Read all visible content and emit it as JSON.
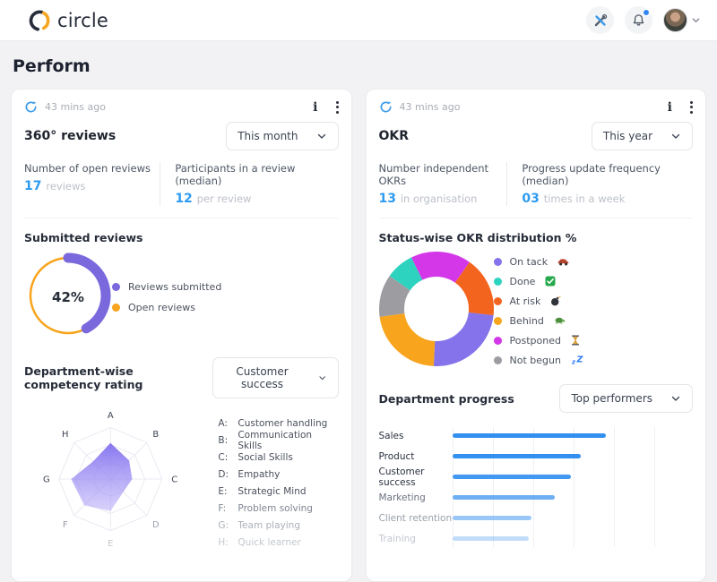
{
  "header": {
    "brand": "circle",
    "brand_colors": {
      "dark": "#272d3b",
      "accent": "#f5a623"
    }
  },
  "page_title": "Perform",
  "cards": [
    {
      "last_updated": "43 mins ago",
      "title": "360° reviews",
      "period": "This month",
      "stats": [
        {
          "label": "Number of open reviews",
          "value": "17",
          "unit": "reviews"
        },
        {
          "label": "Participants in a review (median)",
          "value": "12",
          "unit": "per review"
        }
      ],
      "donut": {
        "type": "donut",
        "title": "Submitted reviews",
        "center_label": "42%",
        "segments": [
          {
            "label": "Reviews submitted",
            "value": 42,
            "color": "#7a68dd"
          },
          {
            "label": "Open reviews",
            "value": 58,
            "color": "#f8a41d"
          }
        ]
      },
      "radar": {
        "type": "radar",
        "title": "Department-wise competency rating",
        "filter": "Customer success",
        "max": 1,
        "rings": 3,
        "fill_color_top": "rgba(124,106,238,0.92)",
        "fill_color_bottom": "rgba(168,155,246,0.45)",
        "grid_color": "#ebe9f2",
        "axes": [
          {
            "key": "A",
            "name": "Customer handling",
            "value": 0.7,
            "label_color": "#3d4452",
            "legend_color": "#4a4f5c"
          },
          {
            "key": "B",
            "name": "Communication Skills",
            "value": 0.51,
            "label_color": "#3d4452",
            "legend_color": "#4a4f5c"
          },
          {
            "key": "C",
            "name": "Social Skills",
            "value": 0.42,
            "label_color": "#3d4452",
            "legend_color": "#4a4f5c"
          },
          {
            "key": "D",
            "name": "Empathy",
            "value": 0.35,
            "label_color": "#9aa0aa",
            "legend_color": "#4a4f5c"
          },
          {
            "key": "E",
            "name": "Strategic Mind",
            "value": 0.62,
            "label_color": "#c4c8ce",
            "legend_color": "#4a4f5c"
          },
          {
            "key": "F",
            "name": "Problem solving",
            "value": 0.72,
            "label_color": "#9aa0aa",
            "legend_color": "#7e8590"
          },
          {
            "key": "G",
            "name": "Team playing",
            "value": 0.76,
            "label_color": "#3d4452",
            "legend_color": "#aab0b9"
          },
          {
            "key": "H",
            "name": "Quick learner",
            "value": 0.48,
            "label_color": "#3d4452",
            "legend_color": "#c3c8cf"
          }
        ]
      }
    },
    {
      "last_updated": "43 mins ago",
      "title": "OKR",
      "period": "This year",
      "stats": [
        {
          "label": "Number independent OKRs",
          "value": "13",
          "unit": "in organisation"
        },
        {
          "label": "Progress update frequency (median)",
          "value": "03",
          "unit": "times in a week"
        }
      ],
      "donut": {
        "type": "donut",
        "title": "Status-wise OKR distribution %",
        "start_angle_deg": -26,
        "segments": [
          {
            "label": "On tack",
            "emoji": "🏎️",
            "icon": "racing-car-icon",
            "value": 24,
            "color": "#8473ea"
          },
          {
            "label": "Done",
            "emoji": "✅",
            "icon": "check-icon",
            "value": 8,
            "color": "#2ed3bf"
          },
          {
            "label": "At risk",
            "emoji": "💣",
            "icon": "bomb-icon",
            "value": 17,
            "color": "#f3641f"
          },
          {
            "label": "Behind",
            "emoji": "🐢",
            "icon": "turtle-icon",
            "value": 22,
            "color": "#f8a41d"
          },
          {
            "label": "Postponed",
            "emoji": "⌛",
            "icon": "hourglass-icon",
            "value": 17,
            "color": "#d337e8"
          },
          {
            "label": "Not begun",
            "emoji": "💤",
            "icon": "zzz-icon",
            "value": 12,
            "color": "#9d9da1"
          }
        ],
        "draw_order": [
          "Postponed",
          "At risk",
          "On tack",
          "Behind",
          "Not begun",
          "Done"
        ]
      },
      "bars": {
        "type": "bar",
        "title": "Department progress",
        "filter": "Top performers",
        "bar_color": "#3390f0",
        "xmax": 100,
        "rows": [
          {
            "label": "Sales",
            "value": 66,
            "opacity": 1,
            "label_color": "#2b3140"
          },
          {
            "label": "Product",
            "value": 55,
            "opacity": 1,
            "label_color": "#2b3140"
          },
          {
            "label": "Customer success",
            "value": 51,
            "opacity": 0.92,
            "label_color": "#2b3140"
          },
          {
            "label": "Marketing",
            "value": 44,
            "opacity": 0.72,
            "label_color": "#6b7280"
          },
          {
            "label": "Client retention",
            "value": 34,
            "opacity": 0.5,
            "label_color": "#9aa0ab"
          },
          {
            "label": "Training",
            "value": 33,
            "opacity": 0.3,
            "label_color": "#c2c7cf"
          }
        ]
      }
    }
  ]
}
